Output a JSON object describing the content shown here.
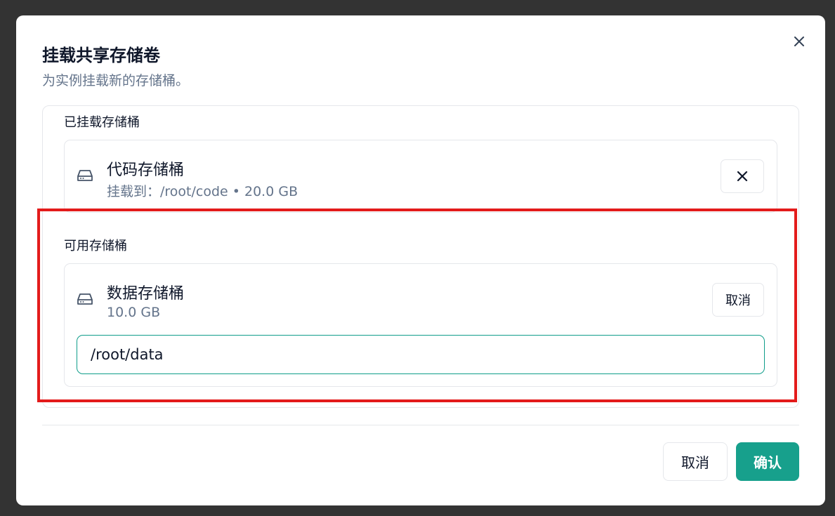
{
  "dialog": {
    "title": "挂载共享存储卷",
    "subtitle": "为实例挂载新的存储桶。"
  },
  "mounted": {
    "heading": "已挂载存储桶",
    "items": [
      {
        "name": "代码存储桶",
        "detail": "挂载到：/root/code • 20.0 GB",
        "icon": "hard-drive-icon"
      }
    ]
  },
  "available": {
    "heading": "可用存储桶",
    "items": [
      {
        "name": "数据存储桶",
        "detail": "10.0 GB",
        "icon": "hard-drive-icon",
        "cancel_label": "取消",
        "mount_path": "/root/data"
      }
    ]
  },
  "footer": {
    "cancel_label": "取消",
    "confirm_label": "确认"
  },
  "colors": {
    "accent": "#17a08c",
    "highlight": "#e31b1b"
  }
}
